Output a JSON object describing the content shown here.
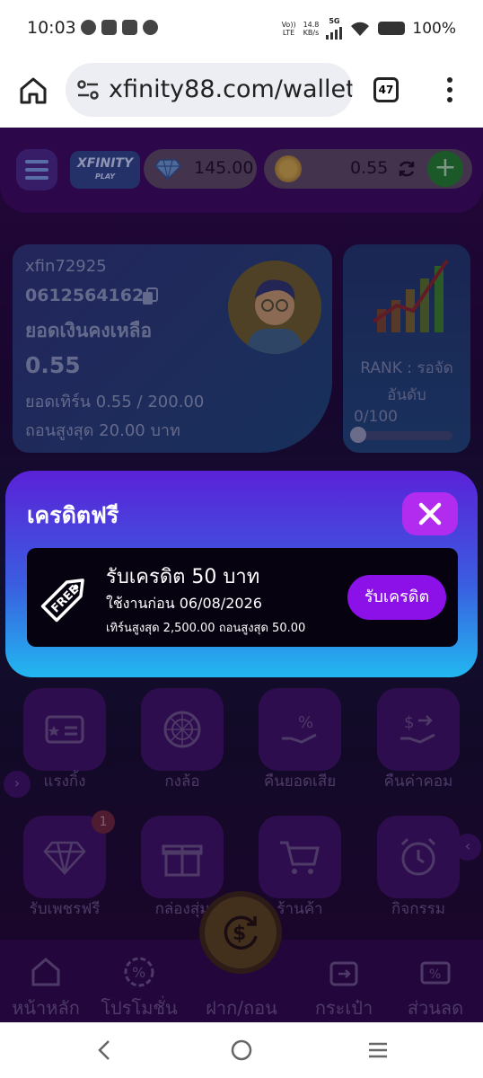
{
  "status_bar": {
    "time": "10:03",
    "net_type_top": "Vo))",
    "net_type_bottom": "LTE",
    "speed_top": "14.8",
    "speed_bottom": "KB/s",
    "signal_label": "5G",
    "battery_percent": "100%"
  },
  "browser": {
    "url": "xfinity88.com/wallet",
    "tab_count": "47"
  },
  "header": {
    "logo_main": "XFINITY",
    "logo_sub": "PLAY",
    "diamond_balance": "145.00",
    "coin_balance": "0.55",
    "plus_label": "+"
  },
  "user": {
    "username": "xfin72925",
    "phone": "0612564162",
    "balance_label": "ยอดเงินคงเหลือ",
    "balance": "0.55",
    "turnover": "ยอดเทิร์น 0.55 / 200.00",
    "max_withdraw": "ถอนสูงสุด 20.00 บาท"
  },
  "rank": {
    "label_line1": "RANK : รอจัด",
    "label_line2": "อันดับ",
    "progress_text": "0/100",
    "progress_fraction": 0.0
  },
  "modal": {
    "title": "เครดิตฟรี",
    "promo_title": "รับเครดิต 50 บาท",
    "promo_expiry": "ใช้งานก่อน 06/08/2026",
    "promo_limits": "เทิร์นสูงสุด 2,500.00 ถอนสูงสุด 50.00",
    "claim_label": "รับเครดิต",
    "tag_text": "FREE"
  },
  "menu_tiles": {
    "row1": [
      "แรงกิ้ง",
      "กงล้อ",
      "คืนยอดเสีย",
      "คืนค่าคอม"
    ],
    "row2": [
      "รับเพชรฟรี",
      "กล่องสุ่ม",
      "ร้านค้า",
      "กิจกรรม"
    ],
    "badge_count": "1"
  },
  "bottom_nav": [
    "หน้าหลัก",
    "โปรโมชั่น",
    "ฝาก/ถอน",
    "กระเป๋า",
    "ส่วนลด"
  ],
  "colors": {
    "modal_gradient_top": "#5a22d8",
    "modal_gradient_bottom": "#22b8f0",
    "claim_button": "#8c10e8",
    "close_button": "#b22cf0",
    "page_bg": "#1b0a35"
  }
}
